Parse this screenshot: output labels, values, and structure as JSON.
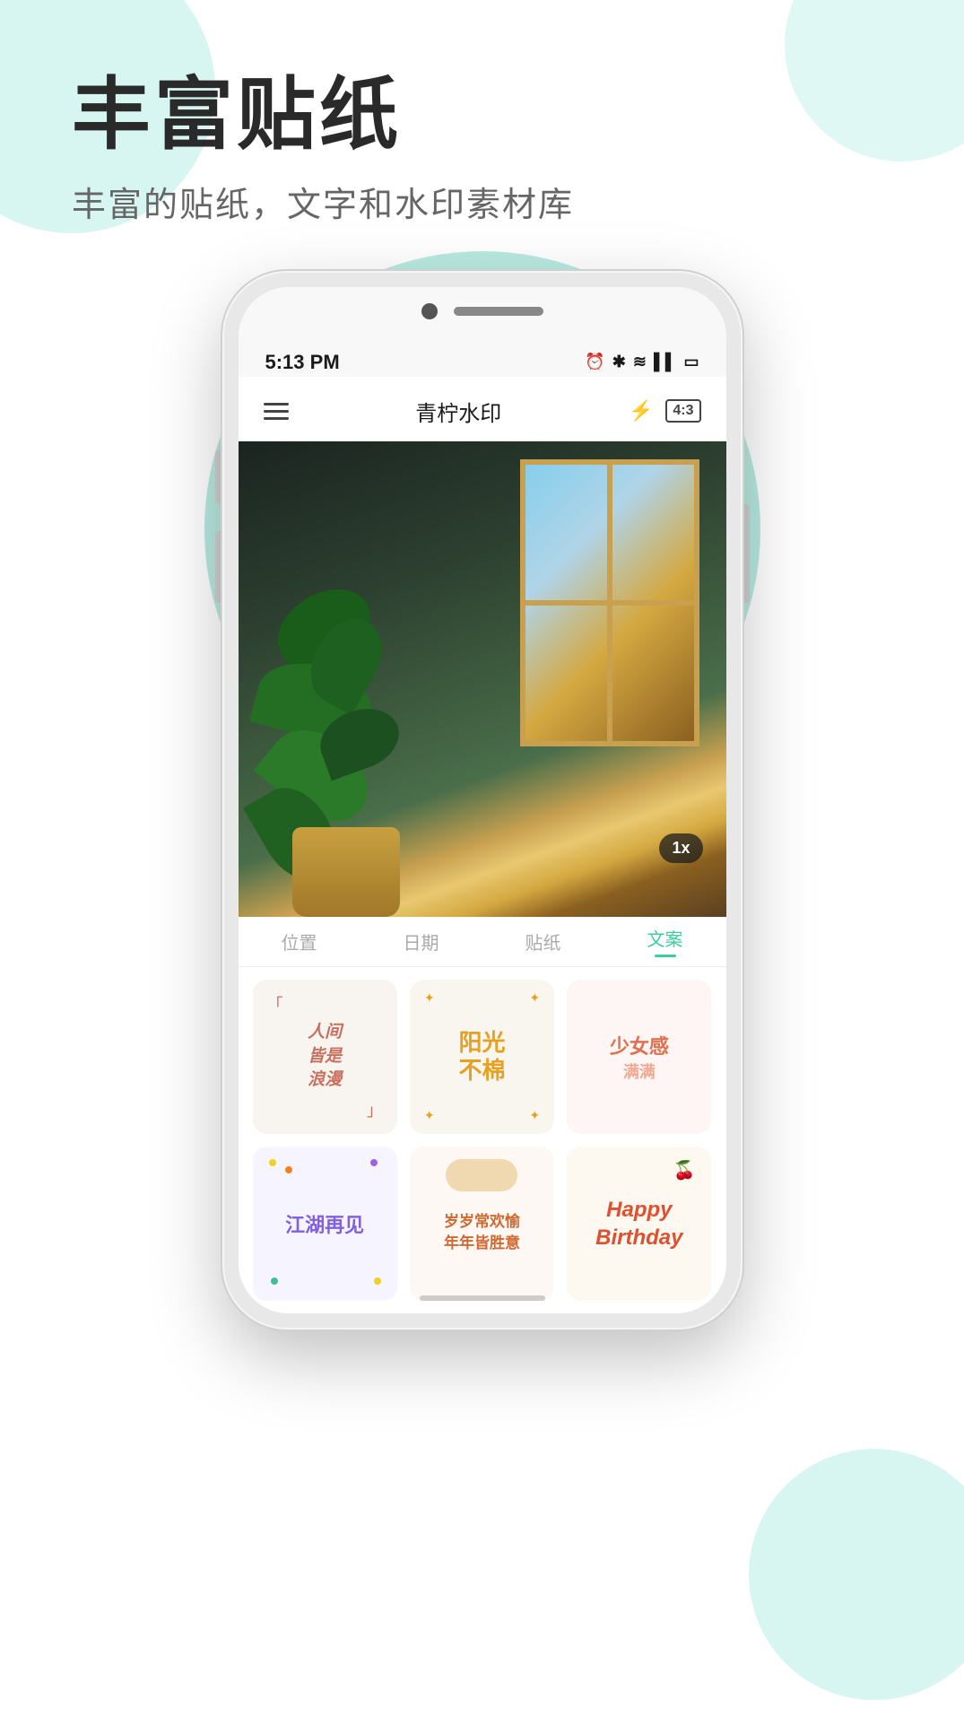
{
  "page": {
    "background_color": "#ffffff"
  },
  "header": {
    "main_title": "丰富贴纸",
    "sub_title": "丰富的贴纸，文字和水印素材库"
  },
  "phone": {
    "status_bar": {
      "time": "5:13 PM",
      "icons": "⏰ ✱ ≋ ▌▌ 🔋"
    },
    "navbar": {
      "title": "青柠水印",
      "ratio": "4:3"
    },
    "tabs": [
      {
        "label": "位置",
        "active": false
      },
      {
        "label": "日期",
        "active": false
      },
      {
        "label": "贴纸",
        "active": false
      },
      {
        "label": "文案",
        "active": true
      }
    ],
    "zoom_badge": "1x",
    "stickers": [
      {
        "id": 1,
        "text": "人间\n皆是\n浪漫",
        "style": "romantic"
      },
      {
        "id": 2,
        "text": "阳光\n不棉",
        "style": "sunshine"
      },
      {
        "id": 3,
        "text": "少女感\n满满",
        "style": "girl"
      },
      {
        "id": 4,
        "text": "江湖再见",
        "style": "jianghu"
      },
      {
        "id": 5,
        "text": "岁岁常欢愉\n年年皆胜意",
        "style": "blessing"
      },
      {
        "id": 6,
        "text": "Happy\nBirthday",
        "style": "birthday"
      }
    ]
  }
}
